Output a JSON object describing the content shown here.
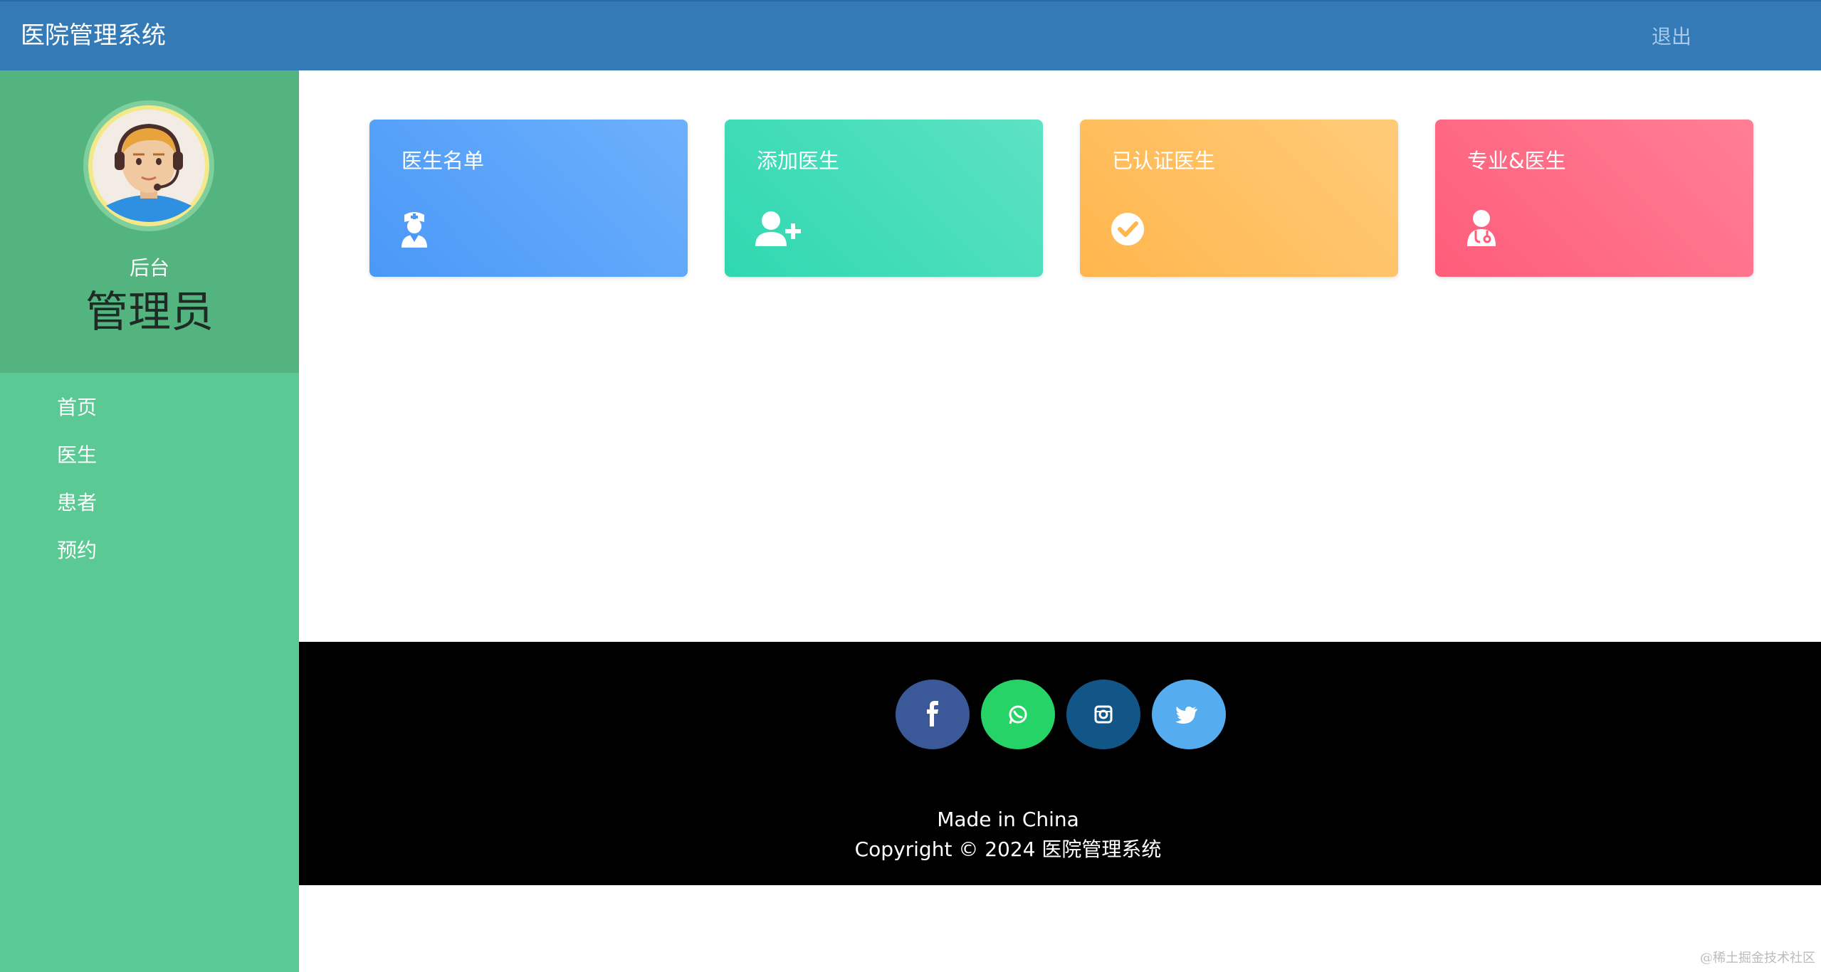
{
  "header": {
    "brand": "医院管理系统",
    "logout_label": "退出"
  },
  "profile": {
    "role_small": "后台",
    "role_big": "管理员"
  },
  "sidebar": {
    "items": [
      {
        "label": "首页"
      },
      {
        "label": "医生"
      },
      {
        "label": "患者"
      },
      {
        "label": "预约"
      }
    ]
  },
  "cards": [
    {
      "title": "医生名单",
      "icon": "doctor-nurse-icon",
      "color": "#4a98f7"
    },
    {
      "title": "添加医生",
      "icon": "user-plus-icon",
      "color": "#2fd8b0"
    },
    {
      "title": "已认证医生",
      "icon": "check-circle-icon",
      "color": "#ffb64d"
    },
    {
      "title": "专业&医生",
      "icon": "user-doctor-icon",
      "color": "#fe5d7a"
    }
  ],
  "footer": {
    "social": [
      {
        "name": "facebook-icon",
        "color": "#3b5998"
      },
      {
        "name": "whatsapp-icon",
        "color": "#25d366"
      },
      {
        "name": "instagram-icon",
        "color": "#125688"
      },
      {
        "name": "twitter-icon",
        "color": "#55acee"
      }
    ],
    "made_in": "Made in China",
    "copyright": "Copyright © 2024 医院管理系统"
  },
  "watermark": "@稀土掘金技术社区"
}
